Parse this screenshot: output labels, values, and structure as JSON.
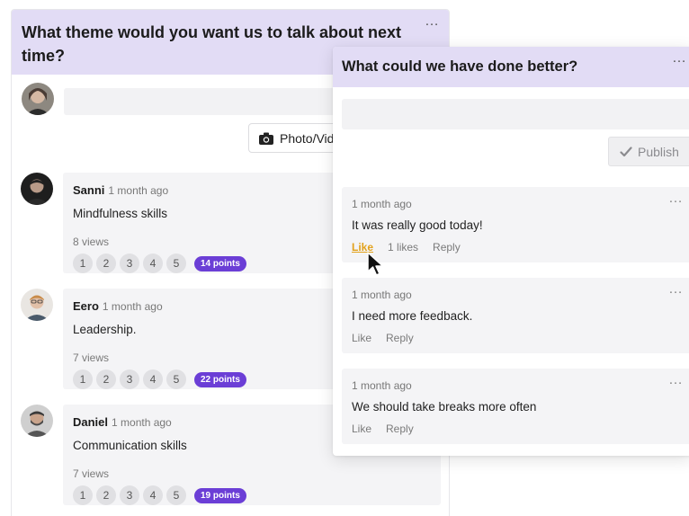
{
  "back_card": {
    "title": "What theme would you want us to talk about next time?",
    "menu_icon": "…",
    "photo_button_label": "Photo/Vid",
    "comments": [
      {
        "name": "Sanni",
        "time": "1 month ago",
        "text": "Mindfulness skills",
        "views": "8 views",
        "points": "14 points"
      },
      {
        "name": "Eero",
        "time": "1 month ago",
        "text": "Leadership.",
        "views": "7 views",
        "points": "22 points"
      },
      {
        "name": "Daniel",
        "time": "1 month ago",
        "text": "Communication skills",
        "views": "7 views",
        "points": "19 points"
      }
    ],
    "ratings": [
      "1",
      "2",
      "3",
      "4",
      "5"
    ]
  },
  "front_card": {
    "title": "What could we have done better?",
    "menu_icon": "…",
    "publish_label": "Publish",
    "comments": [
      {
        "time": "1 month ago",
        "text": "It was really good today!",
        "like": "Like",
        "likes": "1 likes",
        "reply": "Reply"
      },
      {
        "time": "1 month ago",
        "text": "I need more feedback.",
        "like": "Like",
        "reply": "Reply"
      },
      {
        "time": "1 month ago",
        "text": "We should take breaks more often",
        "like": "Like",
        "reply": "Reply"
      }
    ]
  },
  "colors": {
    "header_bg": "#e2dcf5",
    "points_badge": "#6b3ed6",
    "like_active": "#e2a11b"
  }
}
